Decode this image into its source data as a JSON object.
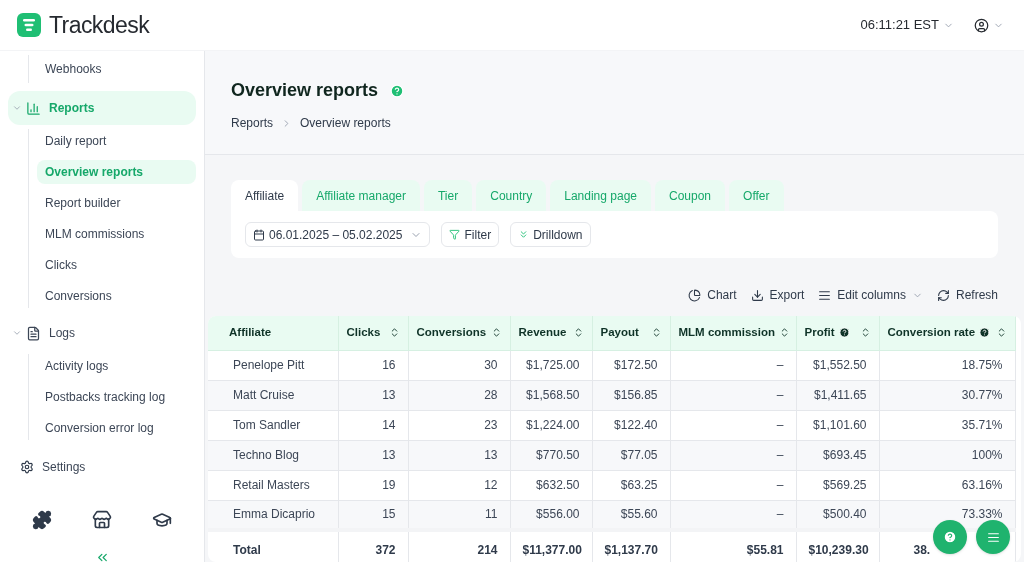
{
  "app": {
    "name": "Trackdesk"
  },
  "header": {
    "time": "06:11:21 EST"
  },
  "sidebar": {
    "items": [
      {
        "kind": "subitem",
        "label": "Webhooks",
        "selected": false
      },
      {
        "kind": "group",
        "label": "Reports",
        "expanded": true,
        "selected": true,
        "children": [
          {
            "label": "Daily report",
            "selected": false
          },
          {
            "label": "Overview reports",
            "selected": true
          },
          {
            "label": "Report builder",
            "selected": false
          },
          {
            "label": "MLM commissions",
            "selected": false
          },
          {
            "label": "Clicks",
            "selected": false
          },
          {
            "label": "Conversions",
            "selected": false
          }
        ]
      },
      {
        "kind": "group",
        "label": "Logs",
        "expanded": true,
        "selected": false,
        "children": [
          {
            "label": "Activity logs",
            "selected": false
          },
          {
            "label": "Postbacks tracking log",
            "selected": false
          },
          {
            "label": "Conversion error log",
            "selected": false
          }
        ]
      },
      {
        "kind": "link",
        "label": "Settings",
        "selected": false
      }
    ]
  },
  "page": {
    "title": "Overview reports",
    "breadcrumb": [
      "Reports",
      "Overview reports"
    ]
  },
  "tabs": [
    {
      "label": "Affiliate",
      "selected": true
    },
    {
      "label": "Affiliate manager",
      "selected": false
    },
    {
      "label": "Tier",
      "selected": false
    },
    {
      "label": "Country",
      "selected": false
    },
    {
      "label": "Landing page",
      "selected": false
    },
    {
      "label": "Coupon",
      "selected": false
    },
    {
      "label": "Offer",
      "selected": false
    }
  ],
  "filters": {
    "date_range": "06.01.2025 – 05.02.2025",
    "filter": "Filter",
    "drilldown": "Drilldown"
  },
  "toolbar": [
    "Chart",
    "Export",
    "Edit columns",
    "Refresh"
  ],
  "table": {
    "columns": [
      {
        "label": "Affiliate",
        "help": false,
        "sortable": false
      },
      {
        "label": "Clicks",
        "help": false,
        "sortable": true
      },
      {
        "label": "Conversions",
        "help": false,
        "sortable": true
      },
      {
        "label": "Revenue",
        "help": false,
        "sortable": true
      },
      {
        "label": "Payout",
        "help": false,
        "sortable": true
      },
      {
        "label": "MLM commission",
        "help": false,
        "sortable": true
      },
      {
        "label": "Profit",
        "help": true,
        "sortable": true
      },
      {
        "label": "Conversion rate",
        "help": true,
        "sortable": true
      }
    ],
    "rows": [
      [
        "Penelope Pitt",
        "16",
        "30",
        "$1,725.00",
        "$172.50",
        "–",
        "$1,552.50",
        "18.75%"
      ],
      [
        "Matt Cruise",
        "13",
        "28",
        "$1,568.50",
        "$156.85",
        "–",
        "$1,411.65",
        "30.77%"
      ],
      [
        "Tom Sandler",
        "14",
        "23",
        "$1,224.00",
        "$122.40",
        "–",
        "$1,101.60",
        "35.71%"
      ],
      [
        "Techno Blog",
        "13",
        "13",
        "$770.50",
        "$77.05",
        "–",
        "$693.45",
        "100%"
      ],
      [
        "Retail Masters",
        "19",
        "12",
        "$632.50",
        "$63.25",
        "–",
        "$569.25",
        "63.16%"
      ],
      [
        "Emma Dicaprio",
        "15",
        "11",
        "$556.00",
        "$55.60",
        "–",
        "$500.40",
        "73.33%"
      ]
    ],
    "total": [
      "Total",
      "372",
      "214",
      "$11,377.00",
      "$1,137.70",
      "$55.81",
      "$10,239.30",
      "38."
    ]
  }
}
